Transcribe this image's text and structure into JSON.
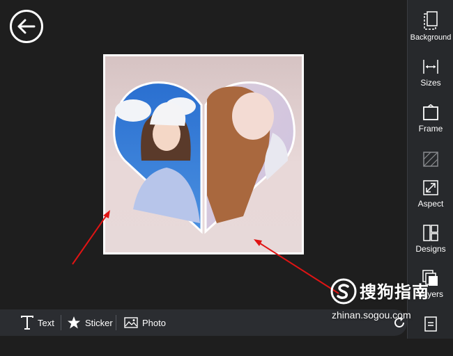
{
  "nav": {
    "back_icon": "arrow-left-icon"
  },
  "sidebar": {
    "items": [
      {
        "id": "background",
        "label": "Background",
        "icon": "background-icon"
      },
      {
        "id": "sizes",
        "label": "Sizes",
        "icon": "resize-icon"
      },
      {
        "id": "frame",
        "label": "Frame",
        "icon": "frame-icon"
      },
      {
        "id": "pattern",
        "label": "",
        "icon": "pattern-icon"
      },
      {
        "id": "aspect",
        "label": "Aspect",
        "icon": "aspect-icon"
      },
      {
        "id": "designs",
        "label": "Designs",
        "icon": "designs-icon"
      },
      {
        "id": "layers",
        "label": "Layers",
        "icon": "layers-icon"
      },
      {
        "id": "save",
        "label": "",
        "icon": "document-icon"
      }
    ]
  },
  "toolbar": {
    "text_label": "Text",
    "sticker_label": "Sticker",
    "photo_label": "Photo",
    "rotate_icon": "rotate-icon"
  },
  "watermark": {
    "brand": "搜狗指南",
    "url": "zhinan.sogou.com"
  },
  "colors": {
    "background": "#1e1e1e",
    "sidebar": "#27292c",
    "annotation_arrow": "#e01414"
  }
}
